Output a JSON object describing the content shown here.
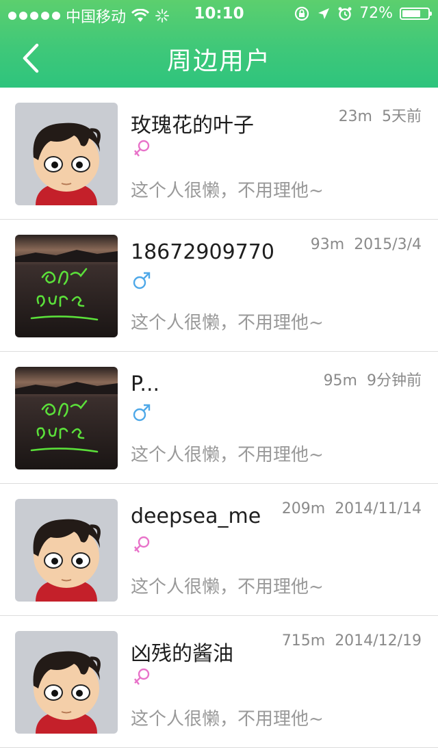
{
  "status": {
    "carrier": "中国移动",
    "time": "10:10",
    "battery": "72%",
    "battery_level": 0.72
  },
  "nav": {
    "title": "周边用户"
  },
  "colors": {
    "header_green": "#3fc879",
    "female_pink": "#e872c9",
    "male_blue": "#4ea8e8"
  },
  "users": [
    {
      "name": "玫瑰花的叶子",
      "distance": "23m",
      "time": "5天前",
      "gender": "female",
      "signature": "这个人很懒，不用理他~",
      "avatar": "cartoon-avatar"
    },
    {
      "name": "18672909770",
      "distance": "93m",
      "time": "2015/3/4",
      "gender": "male",
      "signature": "这个人很懒，不用理他~",
      "avatar": "pure-light-photo"
    },
    {
      "name": "P...",
      "distance": "95m",
      "time": "9分钟前",
      "gender": "male",
      "signature": "这个人很懒，不用理他~",
      "avatar": "pure-light-photo"
    },
    {
      "name": "deepsea_me",
      "distance": "209m",
      "time": "2014/11/14",
      "gender": "female",
      "signature": "这个人很懒，不用理他~",
      "avatar": "cartoon-avatar"
    },
    {
      "name": "凶残的酱油",
      "distance": "715m",
      "time": "2014/12/19",
      "gender": "female",
      "signature": "这个人很懒，不用理他~",
      "avatar": "cartoon-avatar"
    }
  ]
}
